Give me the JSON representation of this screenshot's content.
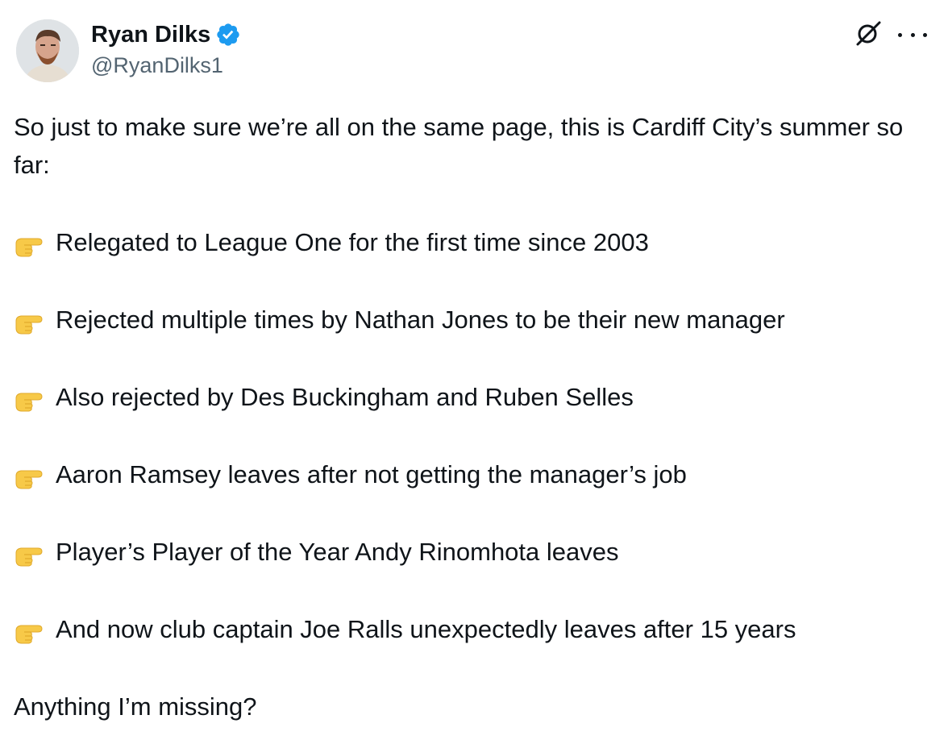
{
  "author": {
    "name": "Ryan Dilks",
    "handle": "@RyanDilks1",
    "verified_icon": "verified-badge-icon",
    "verified_color": "#1d9bf0"
  },
  "actions": {
    "top_icon": "grok-icon",
    "more_icon": "more-icon"
  },
  "tweet": {
    "intro": "So just to make sure we’re all on the same page, this is Cardiff City’s summer so far:",
    "bullet_icon": "pointing-finger-icon",
    "bullets": [
      "Relegated to League One for the first time since 2003",
      "Rejected multiple times by Nathan Jones to be their new manager",
      "Also rejected by Des Buckingham and Ruben Selles",
      "Aaron Ramsey leaves after not getting the manager’s job",
      "Player’s Player of the Year Andy Rinomhota leaves",
      "And now club captain Joe Ralls unexpectedly leaves after 15 years"
    ],
    "closing": "Anything I’m missing?"
  }
}
